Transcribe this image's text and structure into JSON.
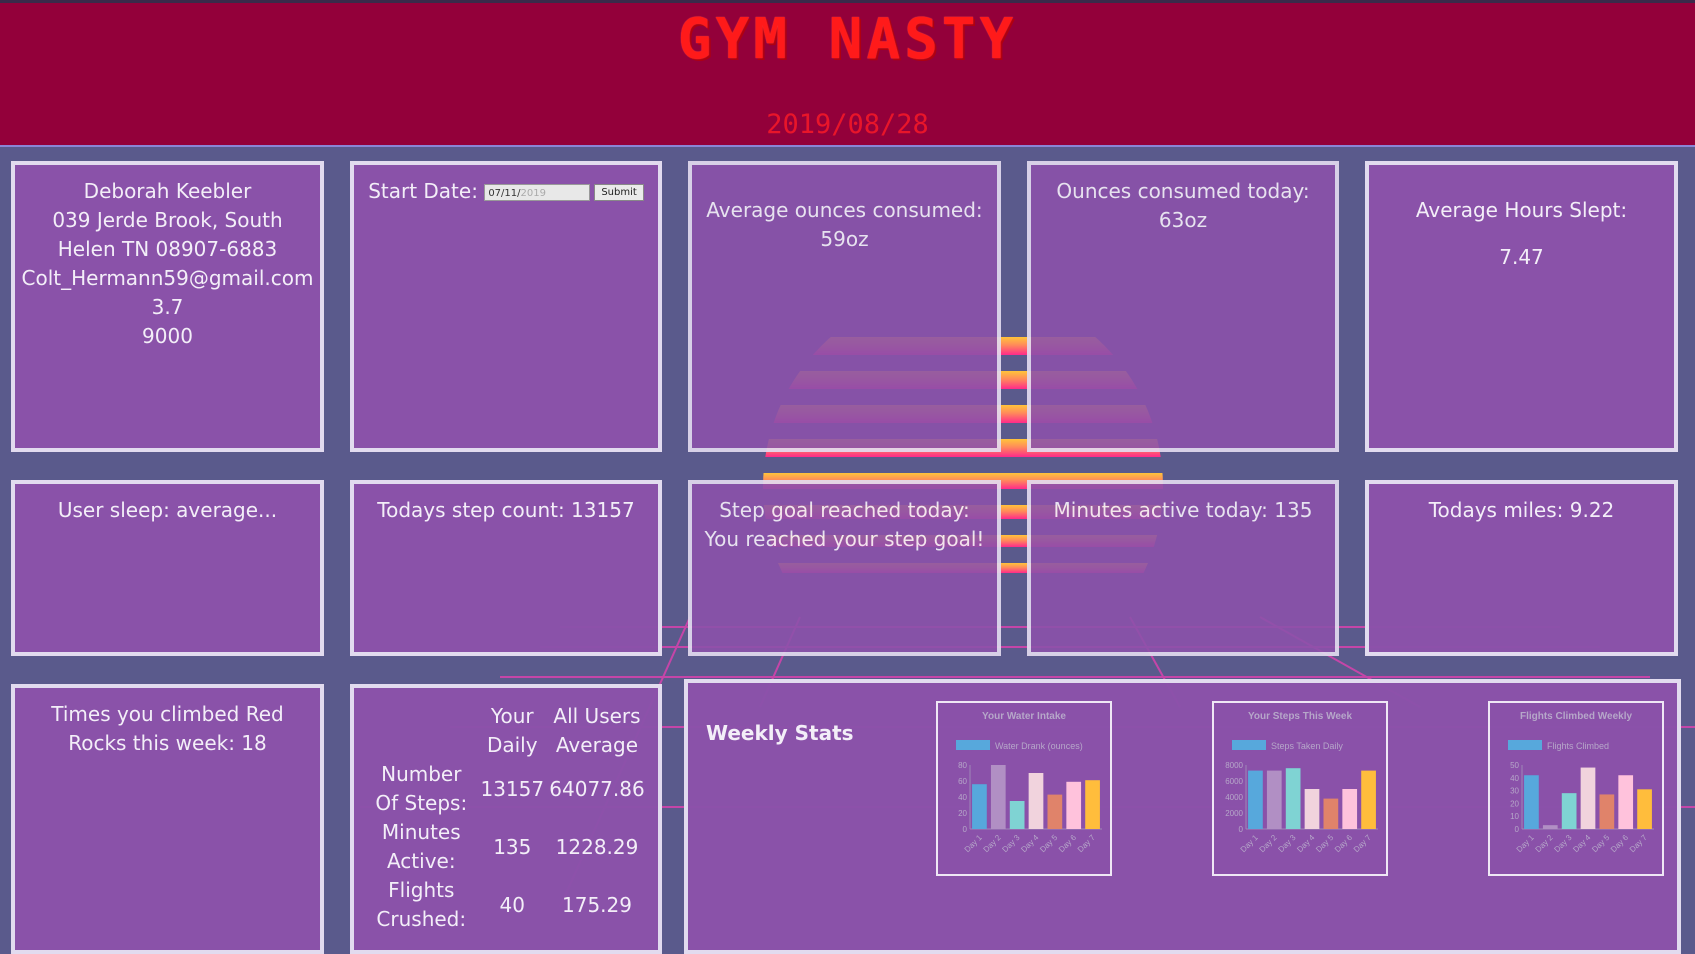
{
  "header": {
    "title": "GYM NASTY",
    "date": "2019/08/28"
  },
  "user": {
    "name": "Deborah Keebler",
    "address_line1": "039 Jerde Brook, South",
    "address_line2": "Helen TN 08907-6883",
    "email": "Colt_Hermann59@gmail.com",
    "stride": "3.7",
    "step_goal": "9000"
  },
  "start_date": {
    "label": "Start Date:",
    "input_value": "07/11/",
    "input_placeholder": "2019",
    "submit_label": "Submit"
  },
  "hydration": {
    "avg_label": "Average ounces consumed:",
    "avg_value": "59oz",
    "today_label": "Ounces consumed today:",
    "today_value": "63oz"
  },
  "sleep": {
    "avg_hours_label": "Average Hours Slept:",
    "avg_hours_value": "7.47",
    "user_sleep_text": "User sleep: average..."
  },
  "activity": {
    "step_count_text": "Todays step count: 13157",
    "goal_label": "Step goal reached today:",
    "goal_message": "You reached your step goal!",
    "minutes_text": "Minutes active today: 135",
    "miles_text": "Todays miles: 9.22",
    "red_rocks_text": "Times you climbed Red Rocks this week: 18"
  },
  "comparison": {
    "col_your": "Your Daily",
    "col_all": "All Users Average",
    "rows": [
      {
        "label": "Number Of Steps:",
        "yours": "13157",
        "all": "64077.86"
      },
      {
        "label": "Minutes Active:",
        "yours": "135",
        "all": "1228.29"
      },
      {
        "label": "Flights Crushed:",
        "yours": "40",
        "all": "175.29"
      }
    ]
  },
  "weekly": {
    "title": "Weekly Stats",
    "colors": [
      "#57a8dc",
      "#b18fc4",
      "#7fd3d3",
      "#f1d3dd",
      "#e0836a",
      "#ffc2dc",
      "#ffbd3c"
    ],
    "legend_color": "#57a8dc"
  },
  "chart_data": [
    {
      "type": "bar",
      "title": "Your Water Intake",
      "categories": [
        "Day 1",
        "Day 2",
        "Day 3",
        "Day 4",
        "Day 5",
        "Day 6",
        "Day 7"
      ],
      "series": [
        {
          "name": "Water Drank (ounces)",
          "values": [
            56,
            80,
            35,
            70,
            43,
            59,
            61
          ]
        }
      ],
      "ylim": [
        0,
        80
      ],
      "yticks": [
        0,
        20,
        40,
        60,
        80
      ],
      "grid": false,
      "legend": "top"
    },
    {
      "type": "bar",
      "title": "Your Steps This Week",
      "categories": [
        "Day 1",
        "Day 2",
        "Day 3",
        "Day 4",
        "Day 5",
        "Day 6",
        "Day 7"
      ],
      "series": [
        {
          "name": "Steps Taken Daily",
          "values": [
            7300,
            7300,
            7600,
            5000,
            3800,
            5000,
            7300
          ]
        }
      ],
      "ylim": [
        0,
        8000
      ],
      "yticks": [
        0,
        2000,
        4000,
        6000,
        8000
      ],
      "grid": false,
      "legend": "top"
    },
    {
      "type": "bar",
      "title": "Flights Climbed Weekly",
      "categories": [
        "Day 1",
        "Day 2",
        "Day 3",
        "Day 4",
        "Day 5",
        "Day 6",
        "Day 7"
      ],
      "series": [
        {
          "name": "Flights Climbed",
          "values": [
            42,
            3,
            28,
            48,
            27,
            42,
            31
          ]
        }
      ],
      "ylim": [
        0,
        50
      ],
      "yticks": [
        0,
        10,
        20,
        30,
        40,
        50
      ],
      "grid": false,
      "legend": "top"
    }
  ]
}
